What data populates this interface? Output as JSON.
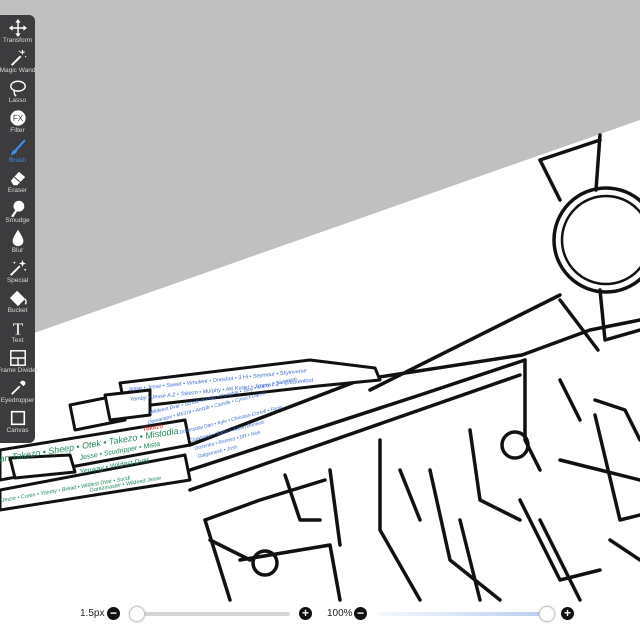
{
  "toolbar": {
    "active_tool": "Brush",
    "accent_color": "#3d8ef0",
    "tools": [
      {
        "id": "transform",
        "label": "Transform",
        "icon": "move-arrows-icon"
      },
      {
        "id": "magic-wand",
        "label": "Magic Wand",
        "icon": "magic-wand-icon"
      },
      {
        "id": "lasso",
        "label": "Lasso",
        "icon": "lasso-icon"
      },
      {
        "id": "filter",
        "label": "Filter",
        "icon": "fx-icon",
        "glyph": "FX"
      },
      {
        "id": "brush",
        "label": "Brush",
        "icon": "brush-icon"
      },
      {
        "id": "eraser",
        "label": "Eraser",
        "icon": "eraser-icon"
      },
      {
        "id": "smudge",
        "label": "Smudge",
        "icon": "smudge-icon"
      },
      {
        "id": "blur",
        "label": "Blur",
        "icon": "drop-icon"
      },
      {
        "id": "special",
        "label": "Special",
        "icon": "sparkle-wand-icon"
      },
      {
        "id": "bucket",
        "label": "Bucket",
        "icon": "bucket-icon"
      },
      {
        "id": "text",
        "label": "Text",
        "icon": "text-icon",
        "glyph": "T"
      },
      {
        "id": "frame-divider",
        "label": "Frame Divider",
        "icon": "frame-divider-icon"
      },
      {
        "id": "eyedropper",
        "label": "Eyedropper",
        "icon": "eyedropper-icon"
      },
      {
        "id": "canvas",
        "label": "Canvas",
        "icon": "canvas-icon"
      }
    ]
  },
  "brush_size": {
    "value_label": "1.5px",
    "level": 0.0
  },
  "opacity": {
    "value_label": "100%",
    "level": 1.0,
    "track_color": "#b9cef0"
  },
  "canvas": {
    "names_blue": [
      "Jesse • Jesse • Sweet • Vimulent • Oneshot • 3 Hi • Seymour • Skyinverse",
      "Yomby • Jesse A.2 • Takezo • Murphy • Aki Kurier • Jimmy 2.2 • Chickenfoot",
      "Wildeest Dvar • School of Pain • Portable • Tony • Marco • Sangreen",
      "Operanator • M5374 • Ant1dr • Camille • Cyrus • Darrin",
      "Doomsday Dan • Kyle • Christian Correll • Fenix",
      "Clawhawk • Satsu • Aaron Bonnett",
      "Gozenka • Rennes • DR • Nick",
      "Galgamesh • Josh"
    ],
    "names_green": [
      "an Takezo • Sheep • Otek • Takezo • Mistodia",
      "Jesse • Scudripper • Mista",
      "Yenway • Wildest Dvar",
      "Jesse • Coren • Yomby • Bread • Wildest Dvar • Sucdi",
      "Gorezmaster • Wildeed Jesse"
    ],
    "name_red": "Takezo",
    "label_color_blue": "#3f6fd1",
    "label_color_green": "#1e8a5a",
    "label_color_red": "#e02020"
  }
}
